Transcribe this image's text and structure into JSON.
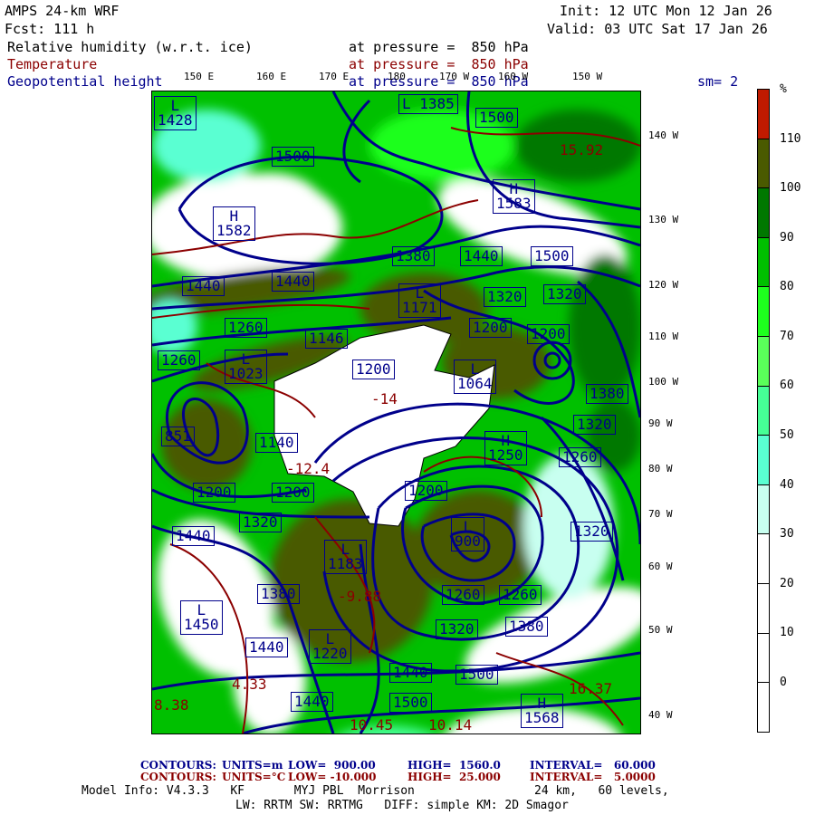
{
  "header": {
    "model": "AMPS 24-km WRF",
    "fcst": "Fcst: 111 h",
    "init": "Init: 12 UTC Mon 12 Jan 26",
    "valid": "Valid: 03 UTC Sat 17 Jan 26",
    "fields": [
      {
        "name": "Relative humidity (w.r.t. ice)",
        "level": "at pressure =  850 hPa",
        "color": "#000000"
      },
      {
        "name": "Temperature",
        "level": "at pressure =  850 hPa",
        "color": "#8b0000"
      },
      {
        "name": "Geopotential height",
        "level": "at pressure =  850 hPa",
        "color": "#00008b"
      }
    ],
    "smoothing": "sm= 2"
  },
  "map": {
    "top_lon_labels": [
      "150 E",
      "160 E",
      "170 E",
      "180",
      "170 W",
      "160 W",
      "150 W"
    ],
    "right_lon_labels": [
      "140 W",
      "130 W",
      "120 W",
      "110 W",
      "100 W",
      "90 W",
      "80 W",
      "70 W",
      "60 W",
      "50 W",
      "40 W"
    ],
    "height_labels": [
      "L\n1428",
      "1500",
      "H\n1582",
      "1440",
      "1440",
      "1260",
      "1260",
      "L\n1023",
      "1146",
      "1200",
      "L 1385",
      "1500",
      "H\n1583",
      "1380",
      "1440",
      "1500",
      "L\n1171",
      "1320",
      "1320",
      "1200",
      "1200",
      "L\n1064",
      "1380",
      "1140",
      "851",
      "1200",
      "1200",
      "1320",
      "1440",
      "L\n1183",
      "1380",
      "L\n1450",
      "1440",
      "L\n1220",
      "1440",
      "H\n1250",
      "1260",
      "1320",
      "1200",
      "L\n900",
      "1320",
      "1260",
      "1260",
      "1320",
      "1380",
      "1440",
      "1500",
      "1500",
      "H\n1568"
    ],
    "temp_labels": [
      "-12.4",
      "4.33",
      "8.38",
      "-9.88",
      "15.92",
      "16.37",
      "10.14",
      "10.45",
      "-14"
    ]
  },
  "colorbar": {
    "unit": "%",
    "labels": [
      "110",
      "100",
      "90",
      "80",
      "70",
      "60",
      "50",
      "40",
      "30",
      "20",
      "10",
      "0"
    ],
    "colors": [
      "#c01a00",
      "#4a5a00",
      "#007800",
      "#00c000",
      "#1eff1e",
      "#5aff5a",
      "#46ff96",
      "#5affd2",
      "#c8fff0",
      "#ffffff",
      "#ffffff",
      "#ffffff",
      "#ffffff"
    ]
  },
  "footer": {
    "height_contours": {
      "label": "CONTOURS:",
      "units": "UNITS=m",
      "low": "LOW=  900.00",
      "high": "HIGH=  1560.0",
      "interval": "INTERVAL=   60.000"
    },
    "temp_contours": {
      "label": "CONTOURS:",
      "units": "UNITS=°C",
      "low": "LOW= -10.000",
      "high": "HIGH=  25.000",
      "interval": "INTERVAL=   5.0000"
    },
    "model_info": "Model Info: V4.3.3   KF       MYJ PBL  Morrison",
    "resolution": "24 km,   60 levels,",
    "physics": "LW: RRTM SW: RRTMG   DIFF: simple KM: 2D Smagor"
  }
}
